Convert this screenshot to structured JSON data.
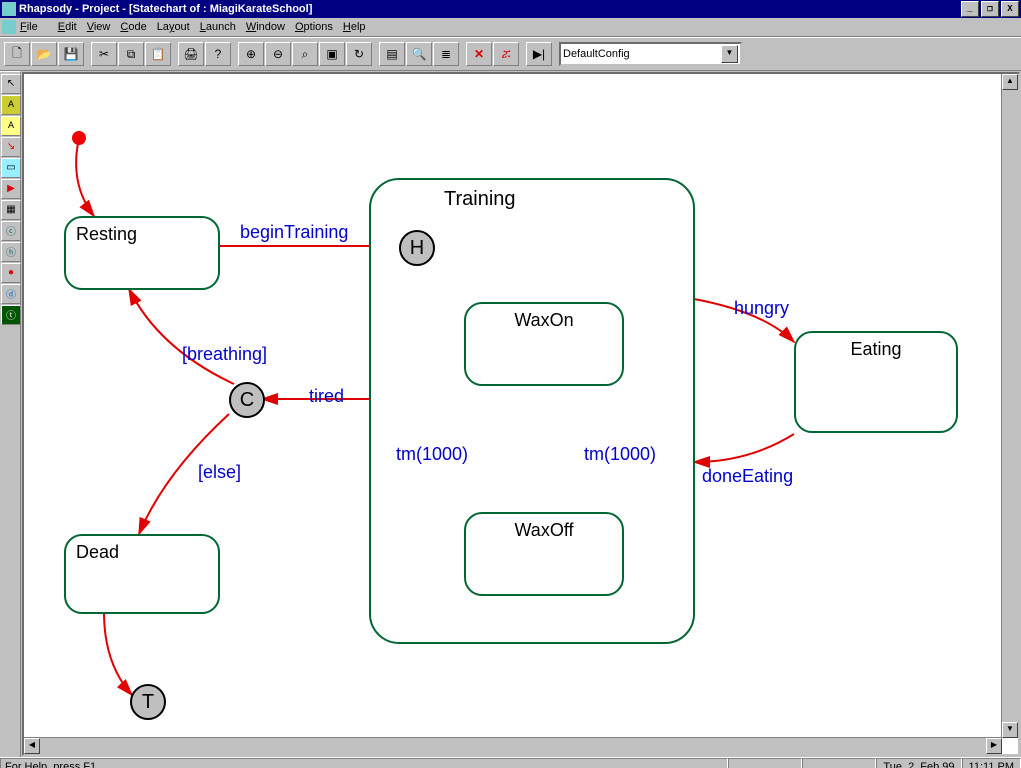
{
  "title": "Rhapsody - Project - [Statechart of : MiagiKarateSchool]",
  "menu": [
    "File",
    "Edit",
    "View",
    "Code",
    "Layout",
    "Launch",
    "Window",
    "Options",
    "Help"
  ],
  "combo": "DefaultConfig",
  "status": {
    "help": "For Help, press F1",
    "date": "Tue, 2. Feb,99",
    "time": "11:11  PM"
  },
  "chart_data": {
    "type": "statechart",
    "composite": {
      "name": "Training",
      "substates": [
        "WaxOn",
        "WaxOff"
      ]
    },
    "states": [
      "Resting",
      "Training",
      "WaxOn",
      "WaxOff",
      "Eating",
      "Dead"
    ],
    "pseudostates": {
      "H": "history",
      "C": "choice",
      "T": "terminate",
      "initial": true
    },
    "transitions": [
      {
        "from": "initial",
        "to": "Resting",
        "label": ""
      },
      {
        "from": "Resting",
        "to": "Training.H",
        "label": "beginTraining"
      },
      {
        "from": "H",
        "to": "WaxOn",
        "label": ""
      },
      {
        "from": "WaxOn",
        "to": "WaxOff",
        "label": "tm(1000)"
      },
      {
        "from": "WaxOff",
        "to": "WaxOn",
        "label": "tm(1000)"
      },
      {
        "from": "Training",
        "to": "C",
        "label": "tired"
      },
      {
        "from": "C",
        "to": "Resting",
        "label": "[breathing]"
      },
      {
        "from": "C",
        "to": "Dead",
        "label": "[else]"
      },
      {
        "from": "Dead",
        "to": "T",
        "label": ""
      },
      {
        "from": "Training",
        "to": "Eating",
        "label": "hungry"
      },
      {
        "from": "Eating",
        "to": "Training",
        "label": "doneEating"
      }
    ]
  },
  "labels": {
    "resting": "Resting",
    "training": "Training",
    "waxon": "WaxOn",
    "waxoff": "WaxOff",
    "eating": "Eating",
    "dead": "Dead",
    "beginTraining": "beginTraining",
    "breathing": "[breathing]",
    "else": "[else]",
    "tired": "tired",
    "tm1": "tm(1000)",
    "tm2": "tm(1000)",
    "hungry": "hungry",
    "doneEating": "doneEating",
    "H": "H",
    "C": "C",
    "T": "T"
  }
}
